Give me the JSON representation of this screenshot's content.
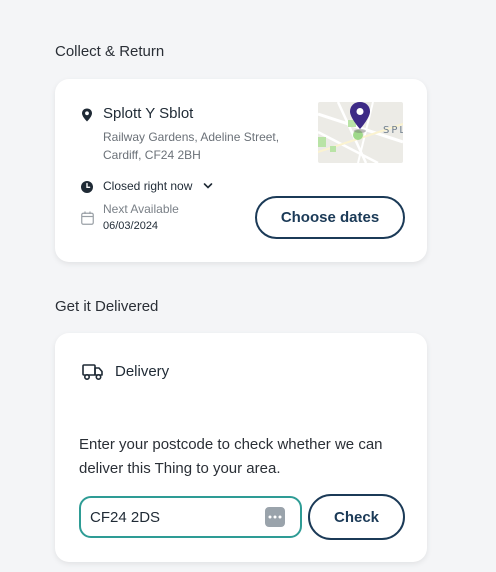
{
  "collect": {
    "section_title": "Collect & Return",
    "location_name": "Splott Y Sblot",
    "address_line1": "Railway Gardens, Adeline Street,",
    "address_line2": "Cardiff, CF24 2BH",
    "map_label": "SPL",
    "status": "Closed right now",
    "next_available_label": "Next Available",
    "next_available_date": "06/03/2024",
    "choose_dates_label": "Choose dates"
  },
  "delivery": {
    "section_title": "Get it Delivered",
    "title": "Delivery",
    "description": "Enter your postcode to check whether we can deliver this Thing to your area.",
    "postcode_value": "CF24 2DS",
    "check_label": "Check"
  },
  "icons": {
    "location": "map-pin-icon",
    "status": "clock-icon",
    "date": "calendar-icon",
    "delivery": "truck-icon",
    "dropdown": "chevron-down-icon",
    "map_marker": "map-marker-icon",
    "autofill": "more-dots-icon"
  },
  "colors": {
    "accent": "#1b3a57",
    "input_border": "#2e9c95",
    "map_marker": "#3d2a86",
    "background": "#f4f5f7",
    "card": "#ffffff"
  }
}
